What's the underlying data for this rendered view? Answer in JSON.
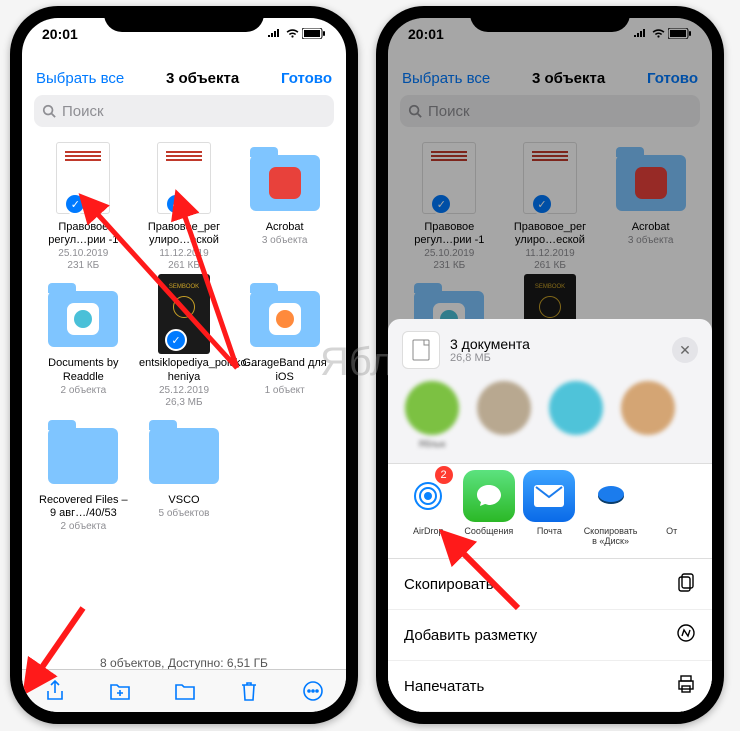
{
  "status": {
    "time": "20:01"
  },
  "nav": {
    "select_all": "Выбрать все",
    "title": "3 объекта",
    "done": "Готово"
  },
  "search": {
    "placeholder": "Поиск"
  },
  "items": [
    {
      "name": "Правовое регул…рии -1",
      "date": "25.10.2019",
      "size": "231 КБ",
      "selected": true,
      "kind": "doc"
    },
    {
      "name": "Правовое_рег улиро…еской",
      "date": "11.12.2019",
      "size": "261 КБ",
      "selected": true,
      "kind": "doc"
    },
    {
      "name": "Acrobat",
      "meta": "3 объекта",
      "kind": "folder",
      "color": "#e8413b"
    },
    {
      "name": "Documents by Readdle",
      "meta": "2 объекта",
      "kind": "folder",
      "color": "#fff",
      "inner": "#4ac0d8"
    },
    {
      "name": "entsiklopediya_poisko…heniya",
      "date": "25.12.2019",
      "size": "26,3 МБ",
      "selected": true,
      "kind": "book"
    },
    {
      "name": "GarageBand для iOS",
      "meta": "1 объект",
      "kind": "folder",
      "color": "#fff",
      "inner": "#ff8a3c"
    },
    {
      "name": "Recovered Files – 9 авг…/40/53",
      "meta": "2 объекта",
      "kind": "folder"
    },
    {
      "name": "VSCO",
      "meta": "5 объектов",
      "kind": "folder"
    }
  ],
  "footer": "8 объектов, Доступно: 6,51 ГБ",
  "sheet": {
    "title": "3 документа",
    "subtitle": "26,8 МБ"
  },
  "contacts": [
    {
      "label": "Яблык"
    },
    {
      "label": ""
    },
    {
      "label": ""
    },
    {
      "label": ""
    }
  ],
  "apps": [
    {
      "label": "AirDrop",
      "bg": "#fff",
      "badge": "2",
      "icon": "airdrop"
    },
    {
      "label": "Сообщения",
      "bg": "linear-gradient(#5ce27f,#2bb826)",
      "icon": "msg"
    },
    {
      "label": "Почта",
      "bg": "linear-gradient(#3ea4ff,#0a6ae8)",
      "icon": "mail"
    },
    {
      "label": "Скопировать в «Диск»",
      "bg": "#fff",
      "icon": "disk"
    },
    {
      "label": "От",
      "bg": "#fff"
    }
  ],
  "actions": [
    {
      "label": "Скопировать",
      "icon": "copy"
    },
    {
      "label": "Добавить разметку",
      "icon": "markup"
    },
    {
      "label": "Напечатать",
      "icon": "print"
    }
  ],
  "watermark": "Яблык"
}
